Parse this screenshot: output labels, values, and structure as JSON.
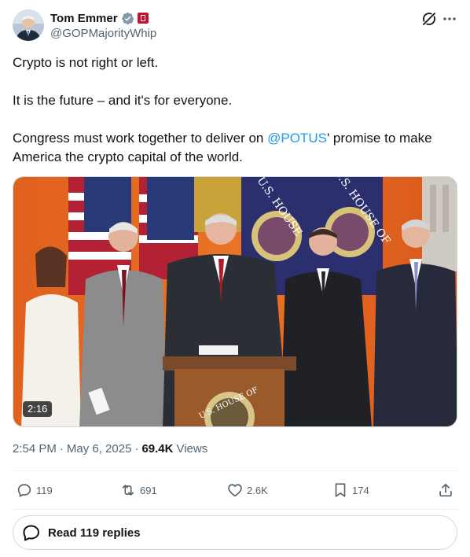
{
  "author": {
    "display_name": "Tom Emmer",
    "handle": "@GOPMajorityWhip"
  },
  "tweet": {
    "line1": "Crypto is not right or left.",
    "line2": "It is the future – and it's for everyone.",
    "line3_pre": "Congress must work together to deliver on ",
    "line3_mention": "@POTUS",
    "line3_post": "' promise to make America the crypto capital of the world."
  },
  "media": {
    "duration": "2:16",
    "seal_text_1": "U.S. HOUSE",
    "seal_text_2": "U.S. HOUSE OF",
    "podium_text": "U.S. HOUSE OF"
  },
  "meta": {
    "time": "2:54 PM",
    "date": "May 6, 2025",
    "views_count": "69.4K",
    "views_label": "Views"
  },
  "actions": {
    "replies": "119",
    "reposts": "691",
    "likes": "2.6K",
    "bookmarks": "174"
  },
  "read_replies_label": "Read 119 replies",
  "colors": {
    "link": "#1d9bf0",
    "text": "#0f1419",
    "secondary": "#536471",
    "verified": "#829aab"
  }
}
